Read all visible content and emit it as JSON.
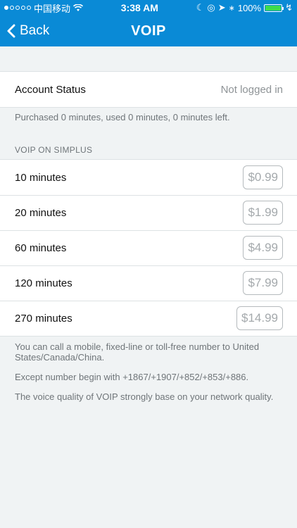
{
  "status_bar": {
    "carrier": "中国移动",
    "time": "3:38 AM",
    "battery": "100%"
  },
  "nav": {
    "back_label": "Back",
    "title": "VOIP"
  },
  "account": {
    "label": "Account Status",
    "value": "Not logged in",
    "note": "Purchased 0 minutes, used 0 minutes, 0 minutes left."
  },
  "plans": {
    "header": "VOIP ON SIMPLUS",
    "items": [
      {
        "label": "10 minutes",
        "price": "$0.99"
      },
      {
        "label": "20 minutes",
        "price": "$1.99"
      },
      {
        "label": "60 minutes",
        "price": "$4.99"
      },
      {
        "label": "120 minutes",
        "price": "$7.99"
      },
      {
        "label": "270 minutes",
        "price": "$14.99"
      }
    ]
  },
  "notes": [
    "You can call a mobile, fixed-line or toll-free number to United States/Canada/China.",
    "Except number begin with +1867/+1907/+852/+853/+886.",
    "The voice quality of VOIP strongly base on your network quality."
  ]
}
